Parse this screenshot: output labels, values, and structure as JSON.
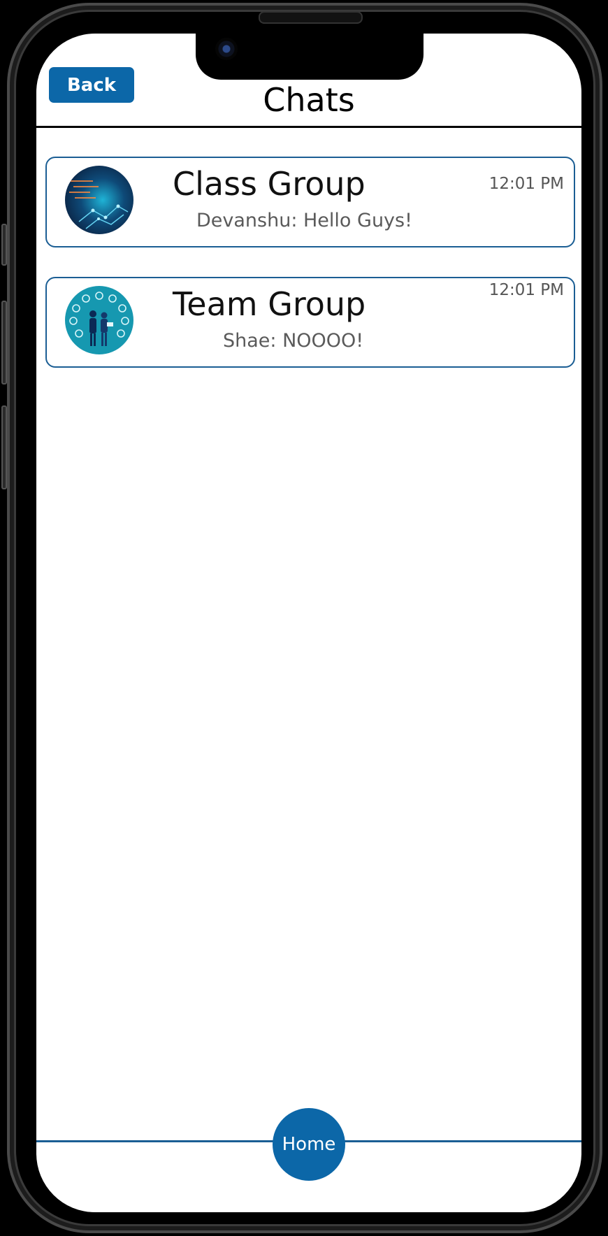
{
  "header": {
    "back_label": "Back",
    "title": "Chats"
  },
  "chats": [
    {
      "name": "Class Group",
      "preview": "Devanshu: Hello Guys!",
      "time": "12:01 PM",
      "avatar_icon": "coding-graphic-icon"
    },
    {
      "name": "Team Group",
      "preview": "Shae: NOOOO!",
      "time": "12:01 PM",
      "avatar_icon": "team-illustration-icon"
    }
  ],
  "footer": {
    "home_label": "Home"
  },
  "colors": {
    "accent": "#0c67a8",
    "card_border": "#1b5e94",
    "background": "#ffffff"
  }
}
